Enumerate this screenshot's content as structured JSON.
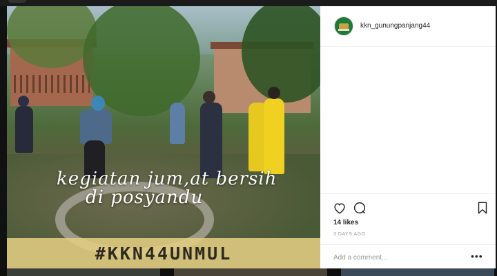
{
  "post": {
    "username": "kkn_gunungpanjang44",
    "photo_caption_line1": "kegiatan jum,at bersih",
    "photo_caption_line2": "di posyandu",
    "photo_hashtag": "#KKN44UNMUL",
    "likes": "14 likes",
    "time_ago": "3 DAYS AGO"
  },
  "comment": {
    "placeholder": "Add a comment...",
    "more_label": "•••"
  },
  "colors": {
    "hashtag_band": "#e2cd82",
    "avatar_bg": "#1f7a3a"
  },
  "icons": [
    "heart-icon",
    "comment-icon",
    "bookmark-icon",
    "more-options-icon"
  ]
}
